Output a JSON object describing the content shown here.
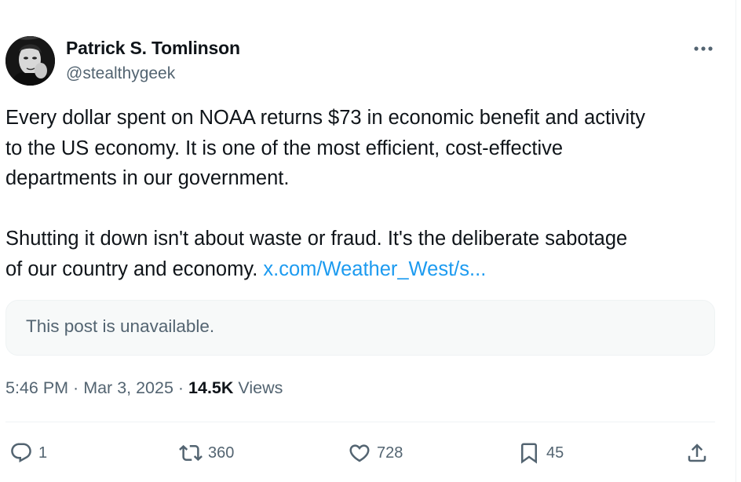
{
  "author": {
    "display_name": "Patrick S. Tomlinson",
    "handle": "@stealthygeek"
  },
  "post": {
    "paragraph_1_lines": [
      "Every dollar spent on NOAA returns $73 in economic benefit and activity",
      "to the US economy. It is one of the most efficient, cost-effective",
      "departments in our government."
    ],
    "paragraph_2_lines": [
      "Shutting it down isn't about waste or fraud. It's the deliberate sabotage",
      "of our country and economy. "
    ],
    "link_text": "x.com/Weather_West/s..."
  },
  "quoted_post": {
    "unavailable_text": "This post is unavailable."
  },
  "meta": {
    "time": "5:46 PM",
    "separator": " · ",
    "date": "Mar 3, 2025",
    "views_count": "14.5K",
    "views_label": " Views"
  },
  "actions": {
    "replies": "1",
    "reposts": "360",
    "likes": "728",
    "bookmarks": "45"
  },
  "icons": {
    "more": "more-horizontal-icon",
    "reply": "reply-bubble-icon",
    "repost": "repost-arrows-icon",
    "like": "heart-icon",
    "bookmark": "bookmark-icon",
    "share": "share-upload-icon"
  },
  "colors": {
    "text_primary": "#0f1419",
    "text_secondary": "#536471",
    "link": "#1d9bf0",
    "quote_background": "#f7f9f9",
    "divider": "#eff3f4"
  }
}
